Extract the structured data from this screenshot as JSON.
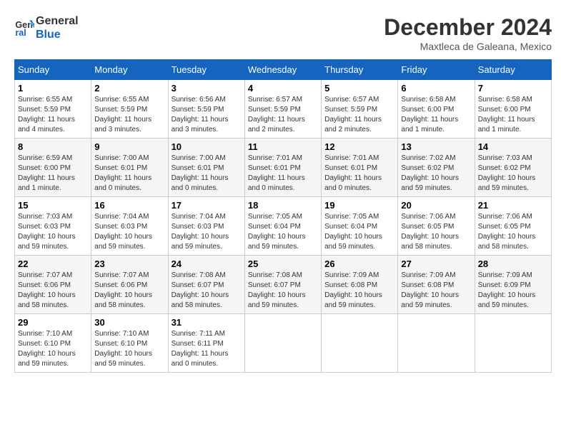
{
  "header": {
    "logo_line1": "General",
    "logo_line2": "Blue",
    "month_title": "December 2024",
    "location": "Maxtleca de Galeana, Mexico"
  },
  "weekdays": [
    "Sunday",
    "Monday",
    "Tuesday",
    "Wednesday",
    "Thursday",
    "Friday",
    "Saturday"
  ],
  "weeks": [
    [
      {
        "day": "1",
        "info": "Sunrise: 6:55 AM\nSunset: 5:59 PM\nDaylight: 11 hours\nand 4 minutes."
      },
      {
        "day": "2",
        "info": "Sunrise: 6:55 AM\nSunset: 5:59 PM\nDaylight: 11 hours\nand 3 minutes."
      },
      {
        "day": "3",
        "info": "Sunrise: 6:56 AM\nSunset: 5:59 PM\nDaylight: 11 hours\nand 3 minutes."
      },
      {
        "day": "4",
        "info": "Sunrise: 6:57 AM\nSunset: 5:59 PM\nDaylight: 11 hours\nand 2 minutes."
      },
      {
        "day": "5",
        "info": "Sunrise: 6:57 AM\nSunset: 5:59 PM\nDaylight: 11 hours\nand 2 minutes."
      },
      {
        "day": "6",
        "info": "Sunrise: 6:58 AM\nSunset: 6:00 PM\nDaylight: 11 hours\nand 1 minute."
      },
      {
        "day": "7",
        "info": "Sunrise: 6:58 AM\nSunset: 6:00 PM\nDaylight: 11 hours\nand 1 minute."
      }
    ],
    [
      {
        "day": "8",
        "info": "Sunrise: 6:59 AM\nSunset: 6:00 PM\nDaylight: 11 hours\nand 1 minute."
      },
      {
        "day": "9",
        "info": "Sunrise: 7:00 AM\nSunset: 6:01 PM\nDaylight: 11 hours\nand 0 minutes."
      },
      {
        "day": "10",
        "info": "Sunrise: 7:00 AM\nSunset: 6:01 PM\nDaylight: 11 hours\nand 0 minutes."
      },
      {
        "day": "11",
        "info": "Sunrise: 7:01 AM\nSunset: 6:01 PM\nDaylight: 11 hours\nand 0 minutes."
      },
      {
        "day": "12",
        "info": "Sunrise: 7:01 AM\nSunset: 6:01 PM\nDaylight: 11 hours\nand 0 minutes."
      },
      {
        "day": "13",
        "info": "Sunrise: 7:02 AM\nSunset: 6:02 PM\nDaylight: 10 hours\nand 59 minutes."
      },
      {
        "day": "14",
        "info": "Sunrise: 7:03 AM\nSunset: 6:02 PM\nDaylight: 10 hours\nand 59 minutes."
      }
    ],
    [
      {
        "day": "15",
        "info": "Sunrise: 7:03 AM\nSunset: 6:03 PM\nDaylight: 10 hours\nand 59 minutes."
      },
      {
        "day": "16",
        "info": "Sunrise: 7:04 AM\nSunset: 6:03 PM\nDaylight: 10 hours\nand 59 minutes."
      },
      {
        "day": "17",
        "info": "Sunrise: 7:04 AM\nSunset: 6:03 PM\nDaylight: 10 hours\nand 59 minutes."
      },
      {
        "day": "18",
        "info": "Sunrise: 7:05 AM\nSunset: 6:04 PM\nDaylight: 10 hours\nand 59 minutes."
      },
      {
        "day": "19",
        "info": "Sunrise: 7:05 AM\nSunset: 6:04 PM\nDaylight: 10 hours\nand 59 minutes."
      },
      {
        "day": "20",
        "info": "Sunrise: 7:06 AM\nSunset: 6:05 PM\nDaylight: 10 hours\nand 58 minutes."
      },
      {
        "day": "21",
        "info": "Sunrise: 7:06 AM\nSunset: 6:05 PM\nDaylight: 10 hours\nand 58 minutes."
      }
    ],
    [
      {
        "day": "22",
        "info": "Sunrise: 7:07 AM\nSunset: 6:06 PM\nDaylight: 10 hours\nand 58 minutes."
      },
      {
        "day": "23",
        "info": "Sunrise: 7:07 AM\nSunset: 6:06 PM\nDaylight: 10 hours\nand 58 minutes."
      },
      {
        "day": "24",
        "info": "Sunrise: 7:08 AM\nSunset: 6:07 PM\nDaylight: 10 hours\nand 58 minutes."
      },
      {
        "day": "25",
        "info": "Sunrise: 7:08 AM\nSunset: 6:07 PM\nDaylight: 10 hours\nand 59 minutes."
      },
      {
        "day": "26",
        "info": "Sunrise: 7:09 AM\nSunset: 6:08 PM\nDaylight: 10 hours\nand 59 minutes."
      },
      {
        "day": "27",
        "info": "Sunrise: 7:09 AM\nSunset: 6:08 PM\nDaylight: 10 hours\nand 59 minutes."
      },
      {
        "day": "28",
        "info": "Sunrise: 7:09 AM\nSunset: 6:09 PM\nDaylight: 10 hours\nand 59 minutes."
      }
    ],
    [
      {
        "day": "29",
        "info": "Sunrise: 7:10 AM\nSunset: 6:10 PM\nDaylight: 10 hours\nand 59 minutes."
      },
      {
        "day": "30",
        "info": "Sunrise: 7:10 AM\nSunset: 6:10 PM\nDaylight: 10 hours\nand 59 minutes."
      },
      {
        "day": "31",
        "info": "Sunrise: 7:11 AM\nSunset: 6:11 PM\nDaylight: 11 hours\nand 0 minutes."
      },
      {
        "day": "",
        "info": ""
      },
      {
        "day": "",
        "info": ""
      },
      {
        "day": "",
        "info": ""
      },
      {
        "day": "",
        "info": ""
      }
    ]
  ]
}
